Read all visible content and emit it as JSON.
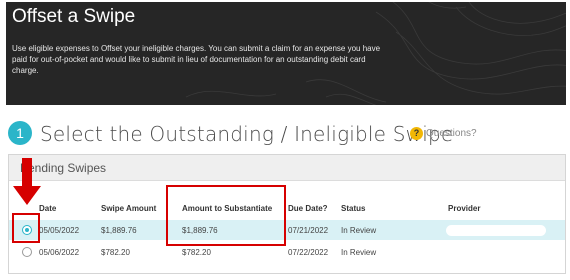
{
  "hero": {
    "title": "Offset a Swipe",
    "description": "Use eligible expenses to Offset your ineligible charges. You can submit a claim for an expense you have paid for out-of-pocket and would like to submit in lieu of documentation for an outstanding debit card charge."
  },
  "step": {
    "number": "1",
    "title": "Select the Outstanding / Ineligible Swipe",
    "questions_icon": "?",
    "questions_label": "Questions?"
  },
  "panel": {
    "title": "Pending Swipes",
    "columns": {
      "date": "Date",
      "swipe_amount": "Swipe Amount",
      "amount_to_substantiate": "Amount to Substantiate",
      "due_date": "Due Date?",
      "status": "Status",
      "provider": "Provider"
    },
    "rows": [
      {
        "selected": true,
        "date": "05/05/2022",
        "swipe_amount": "$1,889.76",
        "amount_to_substantiate": "$1,889.76",
        "due_date": "07/21/2022",
        "status": "In Review",
        "provider": ""
      },
      {
        "selected": false,
        "date": "05/06/2022",
        "swipe_amount": "$782.20",
        "amount_to_substantiate": "$782.20",
        "due_date": "07/22/2022",
        "status": "In Review",
        "provider": ""
      }
    ]
  },
  "colors": {
    "accent": "#2bb5c9",
    "annotation": "#d60000",
    "hero_bg": "#262626",
    "selected_row": "#d9f1f5"
  }
}
